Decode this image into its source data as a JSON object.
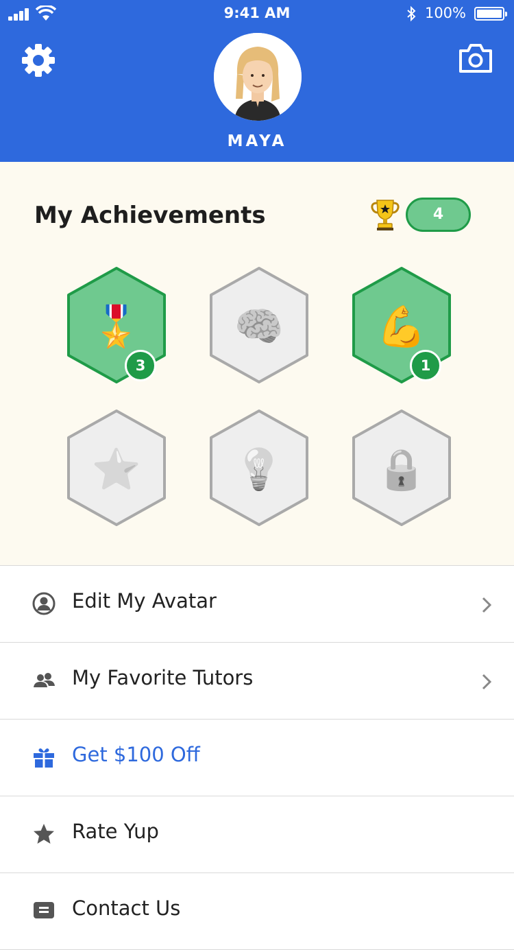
{
  "status_bar": {
    "time": "9:41 AM",
    "battery": "100%"
  },
  "header": {
    "username": "MAYA",
    "background": "#2e69dd"
  },
  "achievements": {
    "title": "My Achievements",
    "total": "4",
    "badges": [
      {
        "name": "medal",
        "emoji": "🎖️",
        "unlocked": true,
        "count": "3"
      },
      {
        "name": "brain",
        "emoji": "🧠",
        "unlocked": false
      },
      {
        "name": "muscle",
        "emoji": "💪",
        "unlocked": true,
        "count": "1"
      },
      {
        "name": "star",
        "emoji": "⭐",
        "unlocked": false
      },
      {
        "name": "lightbulb",
        "emoji": "💡",
        "unlocked": false
      },
      {
        "name": "lock",
        "emoji": "🔒",
        "unlocked": false
      }
    ]
  },
  "menu": {
    "items": [
      {
        "label": "Edit My Avatar",
        "icon": "person-circle-icon",
        "chevron": true
      },
      {
        "label": "My Favorite Tutors",
        "icon": "people-icon",
        "chevron": true
      },
      {
        "label": "Get $100 Off",
        "icon": "gift-icon",
        "chevron": false,
        "color": "#2e69dd"
      },
      {
        "label": "Rate Yup",
        "icon": "star-icon",
        "chevron": false
      },
      {
        "label": "Contact Us",
        "icon": "message-icon",
        "chevron": false
      }
    ]
  },
  "colors": {
    "accent": "#2e69dd",
    "success": "#1f9b48",
    "badge_fill": "#6fc98f",
    "achievements_bg": "#fdfaf0"
  }
}
